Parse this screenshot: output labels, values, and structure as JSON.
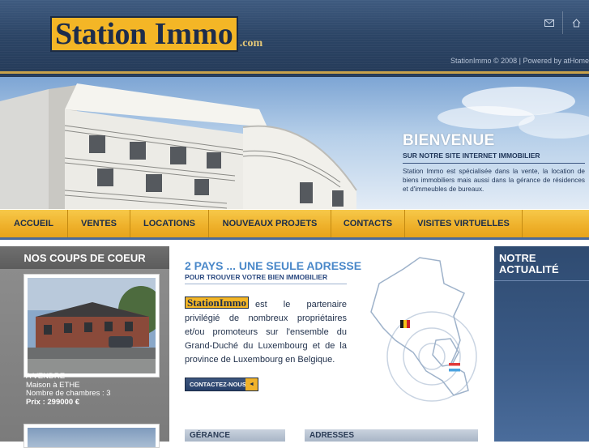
{
  "header": {
    "logo_word1": "Station",
    "logo_word2": "Immo",
    "logo_suffix": ".com",
    "copyright": "StationImmo © 2008  |  Powered by atHome",
    "icons": [
      "envelope-icon",
      "home-icon"
    ]
  },
  "hero": {
    "title": "BIENVENUE",
    "subtitle": "SUR NOTRE SITE INTERNET IMMOBILIER",
    "body": "Station Immo est spécialisée dans la vente, la location de biens immobiliers mais aussi dans la gérance de résidences et d'immeubles de bureaux."
  },
  "nav": {
    "items": [
      {
        "label": "ACCUEIL"
      },
      {
        "label": "VENTES"
      },
      {
        "label": "LOCATIONS"
      },
      {
        "label": "NOUVEAUX PROJETS"
      },
      {
        "label": "CONTACTS"
      },
      {
        "label": "VISITES VIRTUELLES"
      }
    ]
  },
  "favorites": {
    "heading": "NOS COUPS DE COEUR",
    "property": {
      "status": "A VENDRE",
      "type_location": "Maison à ETHE",
      "rooms": "Nombre de chambres : 3",
      "price": "Prix : 299000 €"
    }
  },
  "main": {
    "title": "2 PAYS ... UNE SEULE ADRESSE",
    "subtitle": "POUR TROUVER VOTRE BIEN IMMOBILIER",
    "inline_logo": "StationImmo",
    "body": "est le partenaire privilégié de nombreux propriétaires et/ou promoteurs sur l'ensemble du Grand-Duché du Luxembourg et de la province de Luxembourg en Belgique.",
    "contact_button": "CONTACTEZ-NOUS",
    "tab_gerance": "GÉRANCE",
    "tab_adresses": "ADRESSES"
  },
  "news": {
    "heading_line1": "NOTRE",
    "heading_line2": "ACTUALITÉ"
  },
  "colors": {
    "header_blue": "#2c4566",
    "accent_gold": "#f4b626",
    "nav_text": "#1a2c4a",
    "title_blue": "#4a88c9"
  }
}
